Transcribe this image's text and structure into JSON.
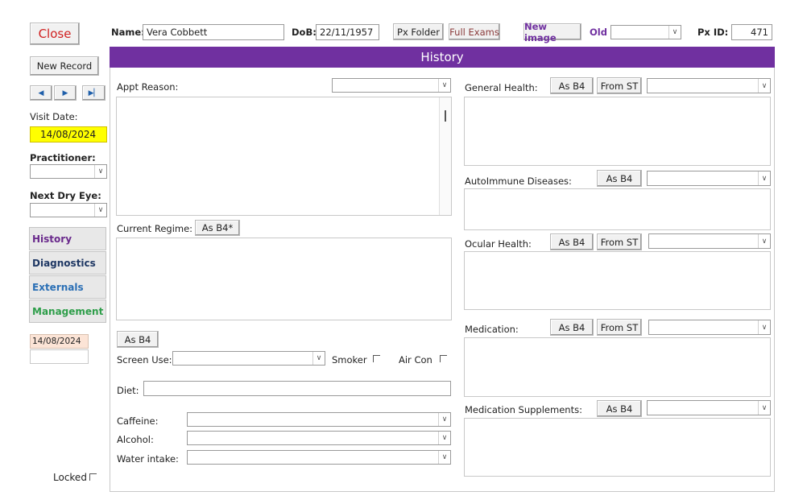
{
  "toolbar": {
    "close_label": "Close",
    "name_label": "Name:",
    "name_value": "Vera Cobbett",
    "dob_label": "DoB:",
    "dob_value": "22/11/1957",
    "px_folder_label": "Px Folder",
    "full_exams_label": "Full Exams",
    "new_image_label": "New image",
    "old_label": "Old",
    "pxid_label": "Px ID:",
    "pxid_value": "471"
  },
  "sidebar": {
    "new_record_label": "New Record",
    "visit_date_label": "Visit Date:",
    "visit_date_value": "14/08/2024",
    "practitioner_label": "Practitioner:",
    "next_dry_eye_label": "Next Dry Eye:",
    "tabs": [
      {
        "label": "History",
        "color": "#6a2a8c"
      },
      {
        "label": "Diagnostics",
        "color": "#1f3864"
      },
      {
        "label": "Externals",
        "color": "#2a6fb5"
      },
      {
        "label": "Management",
        "color": "#2e9e4a"
      }
    ],
    "history_date": "14/08/2024",
    "locked_label": "Locked"
  },
  "header": {
    "title": "History",
    "color": "#7030a0"
  },
  "left": {
    "appt_reason_label": "Appt Reason:",
    "current_regime_label": "Current Regime:",
    "as_b4_star_label": "As B4*",
    "as_b4_label": "As B4",
    "screen_use_label": "Screen Use:",
    "smoker_label": "Smoker",
    "air_con_label": "Air Con",
    "diet_label": "Diet:",
    "caffeine_label": "Caffeine:",
    "alcohol_label": "Alcohol:",
    "water_intake_label": "Water intake:"
  },
  "right": {
    "general_health_label": "General Health:",
    "autoimmune_label": "AutoImmune Diseases:",
    "ocular_health_label": "Ocular Health:",
    "medication_label": "Medication:",
    "supplements_label": "Medication Supplements:",
    "as_b4_label": "As B4",
    "from_st_label": "From ST"
  }
}
